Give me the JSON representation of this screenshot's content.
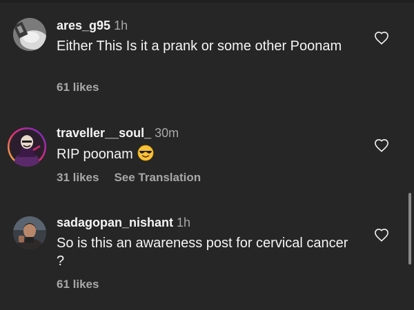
{
  "comments": [
    {
      "username": "ares_g95",
      "time": "1h",
      "text": "Either This Is it a prank or some other Poonam",
      "likes": "61 likes",
      "translation": ""
    },
    {
      "username": "traveller__soul_",
      "time": "30m",
      "text": "RIP poonam",
      "emoji": "😎",
      "likes": "31 likes",
      "translation": "See Translation"
    },
    {
      "username": "sadagopan_nishant",
      "time": "1h",
      "text": "So is this an awareness post for cervical cancer ?",
      "likes": "61 likes",
      "translation": ""
    }
  ],
  "icons": {
    "like": "heart-outline-icon",
    "emoji": "smiling-face-with-sunglasses"
  },
  "colors": {
    "background": "#262626",
    "primary_text": "#f5f5f5",
    "secondary_text": "#a8a8a8",
    "story_ring_start": "#f9ce34",
    "story_ring_mid": "#ee2a7b",
    "story_ring_end": "#6228d7"
  }
}
